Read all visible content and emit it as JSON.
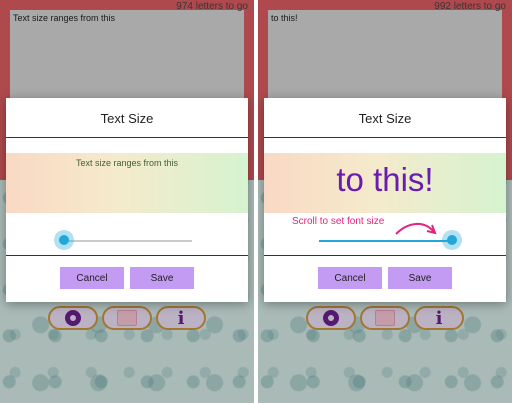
{
  "left": {
    "text_content": "Text size ranges from this",
    "counter": "974 letters to go",
    "dialog": {
      "title": "Text Size",
      "preview_text": "Text size ranges from this",
      "slider_level": 0.0,
      "cancel_label": "Cancel",
      "save_label": "Save"
    }
  },
  "right": {
    "text_content": "to this!",
    "counter": "992 letters to go",
    "dialog": {
      "title": "Text Size",
      "preview_text": "to this!",
      "hint": "Scroll to set font size",
      "slider_level": 1.0,
      "cancel_label": "Cancel",
      "save_label": "Save"
    }
  },
  "toolbar": {
    "icons": [
      "gear-icon",
      "paint-bucket-icon",
      "info-icon"
    ]
  },
  "colors": {
    "accent_purple": "#c39bf2",
    "slider_blue": "#21a8d8",
    "hint_pink": "#e2237f",
    "preview_text_purple": "#6a1bb0"
  }
}
